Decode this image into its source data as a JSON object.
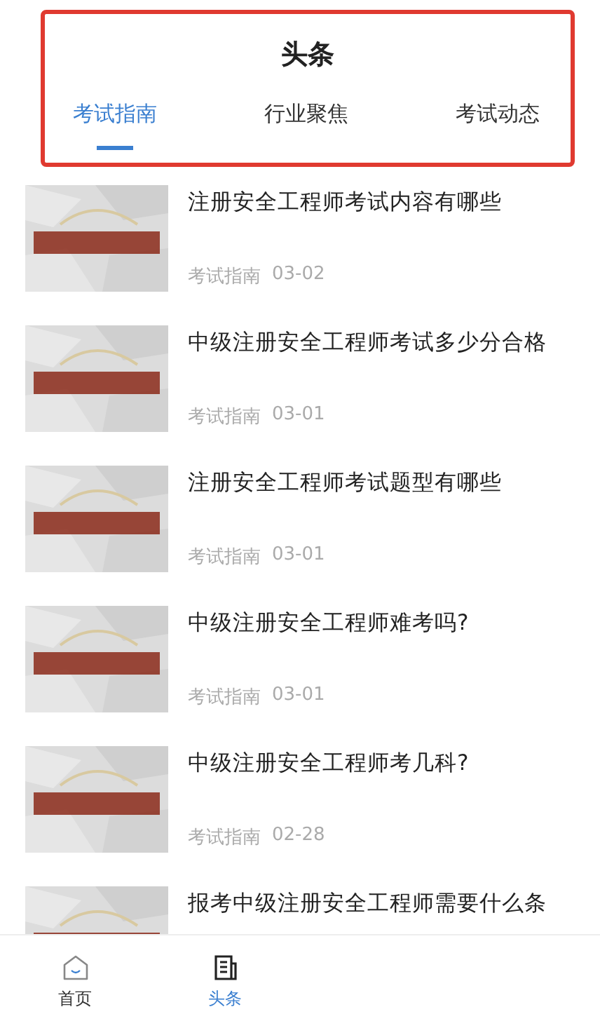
{
  "header": {
    "title": "头条"
  },
  "tabs": [
    {
      "label": "考试指南",
      "selected": true
    },
    {
      "label": "行业聚焦",
      "selected": false
    },
    {
      "label": "考试动态",
      "selected": false
    }
  ],
  "articles": [
    {
      "kind": "picture",
      "title": "注册安全工程师考试内容有哪些",
      "category": "考试指南",
      "date": "03-02"
    },
    {
      "kind": "picture",
      "title": "中级注册安全工程师考试多少分合格",
      "category": "考试指南",
      "date": "03-01"
    },
    {
      "kind": "picture",
      "title": "注册安全工程师考试题型有哪些",
      "category": "考试指南",
      "date": "03-01"
    },
    {
      "kind": "picture",
      "title": "中级注册安全工程师难考吗?",
      "category": "考试指南",
      "date": "03-01"
    },
    {
      "kind": "picture",
      "title": "中级注册安全工程师考几科?",
      "category": "考试指南",
      "date": "02-28"
    },
    {
      "kind": "picture",
      "title": "报考中级注册安全工程师需要什么条"
    }
  ],
  "bottom_nav": [
    {
      "label": "首页",
      "kind": "home",
      "selected": false
    },
    {
      "label": "头条",
      "kind": "news",
      "selected": true
    }
  ]
}
